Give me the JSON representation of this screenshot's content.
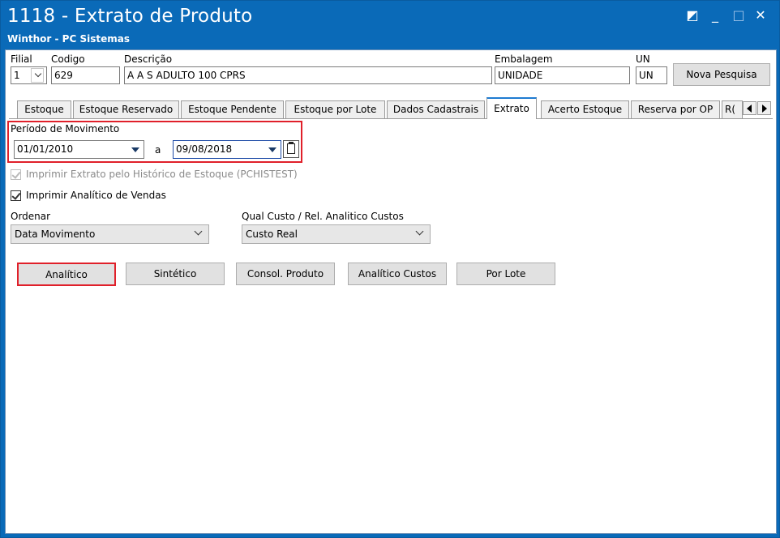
{
  "window": {
    "title": "1118 - Extrato de Produto",
    "subtitle": "Winthor - PC Sistemas",
    "controls": {
      "restore": "◩",
      "minimize": "_",
      "maximize": "□",
      "close": "✕"
    }
  },
  "header": {
    "filial_label": "Filial",
    "filial_value": "1",
    "codigo_label": "Codigo",
    "codigo_value": "629",
    "descricao_label": "Descrição",
    "descricao_value": "A A S ADULTO 100 CPRS",
    "embalagem_label": "Embalagem",
    "embalagem_value": "UNIDADE",
    "un_label": "UN",
    "un_value": "UN",
    "nova_pesquisa": "Nova Pesquisa"
  },
  "tabs": [
    {
      "label": "Estoque"
    },
    {
      "label": "Estoque Reservado"
    },
    {
      "label": "Estoque Pendente"
    },
    {
      "label": "Estoque por Lote"
    },
    {
      "label": "Dados Cadastrais"
    },
    {
      "label": "Extrato",
      "active": true
    },
    {
      "label": "Acerto Estoque"
    },
    {
      "label": "Reserva por OP"
    },
    {
      "label": "R("
    }
  ],
  "periodo": {
    "label": "Período de Movimento",
    "start": "01/01/2010",
    "separator": "a",
    "end": "09/08/2018"
  },
  "options": {
    "historico_label": "Imprimir Extrato pelo Histórico de Estoque (PCHISTEST)",
    "historico_checked": true,
    "historico_enabled": false,
    "analitico_vendas_label": "Imprimir Analítico de Vendas",
    "analitico_vendas_checked": true
  },
  "ordenar": {
    "label": "Ordenar",
    "value": "Data Movimento"
  },
  "qual_custo": {
    "label": "Qual Custo / Rel. Analitico Custos",
    "value": "Custo Real"
  },
  "actions": {
    "analitico": "Analítico",
    "sintetico": "Sintético",
    "consol_produto": "Consol. Produto",
    "analitico_custos": "Analítico Custos",
    "por_lote": "Por Lote"
  },
  "colors": {
    "titlebar": "#0a6ab8",
    "highlight": "#e0202a",
    "active_tab_accent": "#1f7bd1"
  }
}
